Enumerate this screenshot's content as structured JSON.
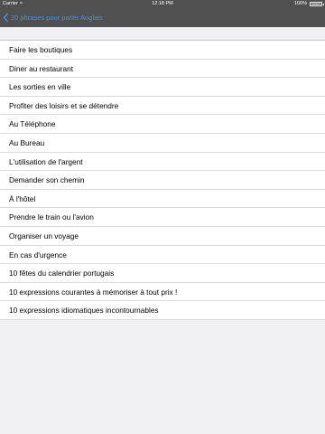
{
  "status_bar": {
    "carrier": "Carrier",
    "time": "12:18 PM",
    "battery_text": "100%",
    "battery_level": 1.0
  },
  "nav": {
    "back_label": "20 phrases pour parler Anglais"
  },
  "items": [
    {
      "label": "Faire les boutiques"
    },
    {
      "label": "Diner au restaurant"
    },
    {
      "label": "Les sorties en ville"
    },
    {
      "label": "Profiter des loisirs et se détendre"
    },
    {
      "label": "Au Téléphone"
    },
    {
      "label": "Au Bureau"
    },
    {
      "label": "L'utilisation de l'argent"
    },
    {
      "label": "Demander son chemin"
    },
    {
      "label": "À l'hôtel"
    },
    {
      "label": "Prendre le train ou l'avion"
    },
    {
      "label": "Organiser un voyage"
    },
    {
      "label": "En cas d'urgence"
    },
    {
      "label": "10 fêtes du calendrier portugais"
    },
    {
      "label": "10 expressions courantes à mémoriser à tout prix !"
    },
    {
      "label": "10 expressions idiomatiques incontournables"
    }
  ]
}
